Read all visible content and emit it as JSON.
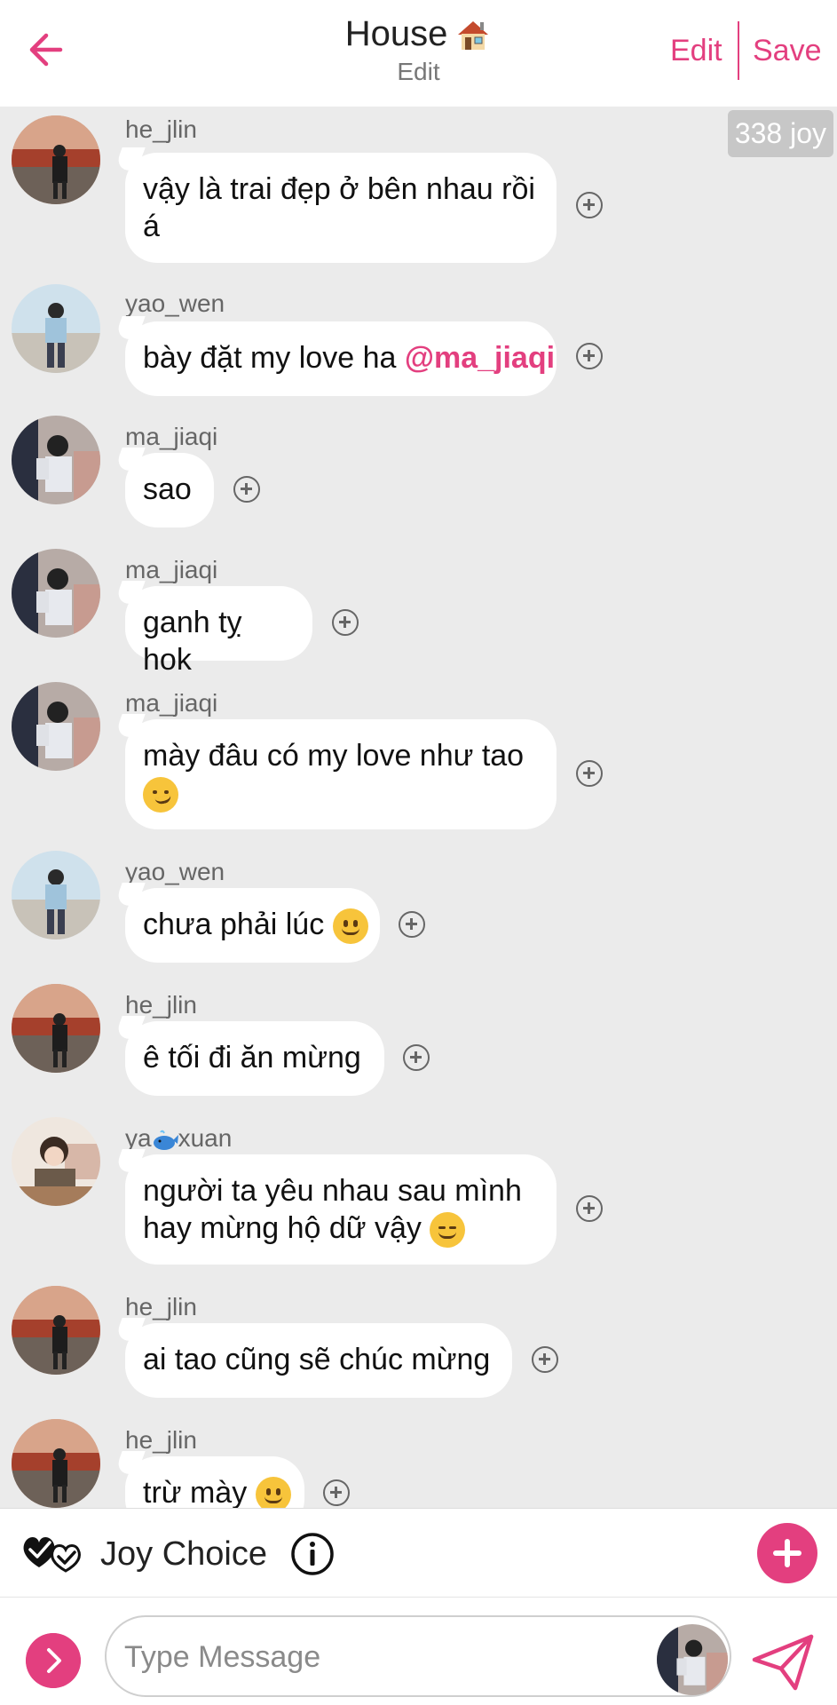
{
  "header": {
    "title": "House",
    "subtitle": "Edit",
    "edit_label": "Edit",
    "save_label": "Save",
    "accent_color": "#e33f7f"
  },
  "chat": {
    "joy_badge": "338 joy",
    "messages": [
      {
        "username": "he_jlin",
        "text": "vậy là trai đẹp ở bên nhau rồi á",
        "avatar": "he_jlin"
      },
      {
        "username": "yao_wen",
        "text": "bày đặt my love ha ",
        "mention": "@ma_jiaqi",
        "avatar": "yao_wen"
      },
      {
        "username": "ma_jiaqi",
        "text": "sao",
        "avatar": "ma_jiaqi"
      },
      {
        "username": "ma_jiaqi",
        "text": "ganh tỵ hok",
        "avatar": "ma_jiaqi"
      },
      {
        "username": "ma_jiaqi",
        "text": "mày đâu có my love như tao",
        "emoji": "smirk",
        "avatar": "ma_jiaqi"
      },
      {
        "username": "yao_wen",
        "text": "chưa phải lúc",
        "emoji": "slight-smile",
        "avatar": "yao_wen"
      },
      {
        "username": "he_jlin",
        "text": "ê tối đi ăn mừng",
        "avatar": "he_jlin"
      },
      {
        "username_pre": "ya",
        "username_post": "xuan",
        "username_emoji": "whale",
        "text": "người ta yêu nhau sau mình hay mừng hộ dữ vậy",
        "emoji": "relieved",
        "avatar": "yaxuan"
      },
      {
        "username": "he_jlin",
        "text": "ai tao cũng sẽ chúc mừng",
        "avatar": "he_jlin"
      },
      {
        "username": "he_jlin",
        "text": "trừ mày",
        "emoji": "slight-smile",
        "avatar": "he_jlin"
      }
    ]
  },
  "joy_bar": {
    "label": "Joy Choice",
    "icon": "double-check-heart-icon"
  },
  "input": {
    "placeholder": "Type Message"
  }
}
